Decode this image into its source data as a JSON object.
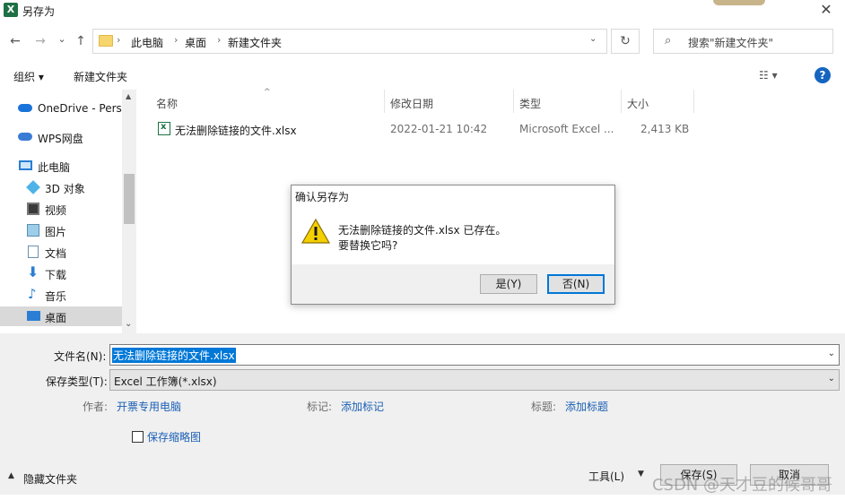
{
  "window": {
    "title": "另存为",
    "app_icon_letter": "X",
    "close_label": "✕"
  },
  "nav": {
    "back_icon": "←",
    "forward_icon": "→",
    "recent_icon": "⌄",
    "up_icon": "↑",
    "breadcrumbs": [
      "此电脑",
      "桌面",
      "新建文件夹"
    ],
    "crumb_sep": "›",
    "first_sep": "›",
    "refresh_icon": "↻",
    "search_placeholder": "搜索\"新建文件夹\""
  },
  "toolbar": {
    "organize": "组织 ▾",
    "new_folder": "新建文件夹",
    "view_icon": "☷ ▾",
    "help": "?"
  },
  "sidebar": {
    "items": [
      {
        "label": "OneDrive - Perso"
      },
      {
        "label": "WPS网盘"
      },
      {
        "label": "此电脑"
      },
      {
        "label": "3D 对象"
      },
      {
        "label": "视频"
      },
      {
        "label": "图片"
      },
      {
        "label": "文档"
      },
      {
        "label": "下载"
      },
      {
        "label": "音乐"
      },
      {
        "label": "桌面"
      }
    ],
    "scroll_up": "▲",
    "scroll_down": "⌄"
  },
  "file_list": {
    "columns": [
      "名称",
      "修改日期",
      "类型",
      "大小"
    ],
    "sort_indicator": "^",
    "rows": [
      {
        "name": "无法删除链接的文件.xlsx",
        "modified": "2022-01-21 10:42",
        "type": "Microsoft Excel ...",
        "size": "2,413 KB"
      }
    ]
  },
  "form": {
    "filename_label": "文件名(N):",
    "filename_value": "无法删除链接的文件.xlsx",
    "savetype_label": "保存类型(T):",
    "savetype_value": "Excel 工作簿(*.xlsx)",
    "author_label": "作者:",
    "author_value": "开票专用电脑",
    "tags_label": "标记:",
    "tags_value": "添加标记",
    "title_label": "标题:",
    "title_value": "添加标题",
    "thumbnail_label": "保存缩略图",
    "hide_folders": "隐藏文件夹",
    "tools_label": "工具(L)",
    "save_label": "保存(S)",
    "cancel_label": "取消"
  },
  "dialog": {
    "title": "确认另存为",
    "message_line1": "无法删除链接的文件.xlsx 已存在。",
    "message_line2": "要替换它吗?",
    "yes_label": "是(Y)",
    "no_label": "否(N)"
  },
  "watermark": "CSDN @天才豆的候哥哥",
  "colors": {
    "accent": "#0078d7",
    "link": "#1a5fb4",
    "excel_green": "#1d7145",
    "warning_yellow": "#f5d000"
  }
}
